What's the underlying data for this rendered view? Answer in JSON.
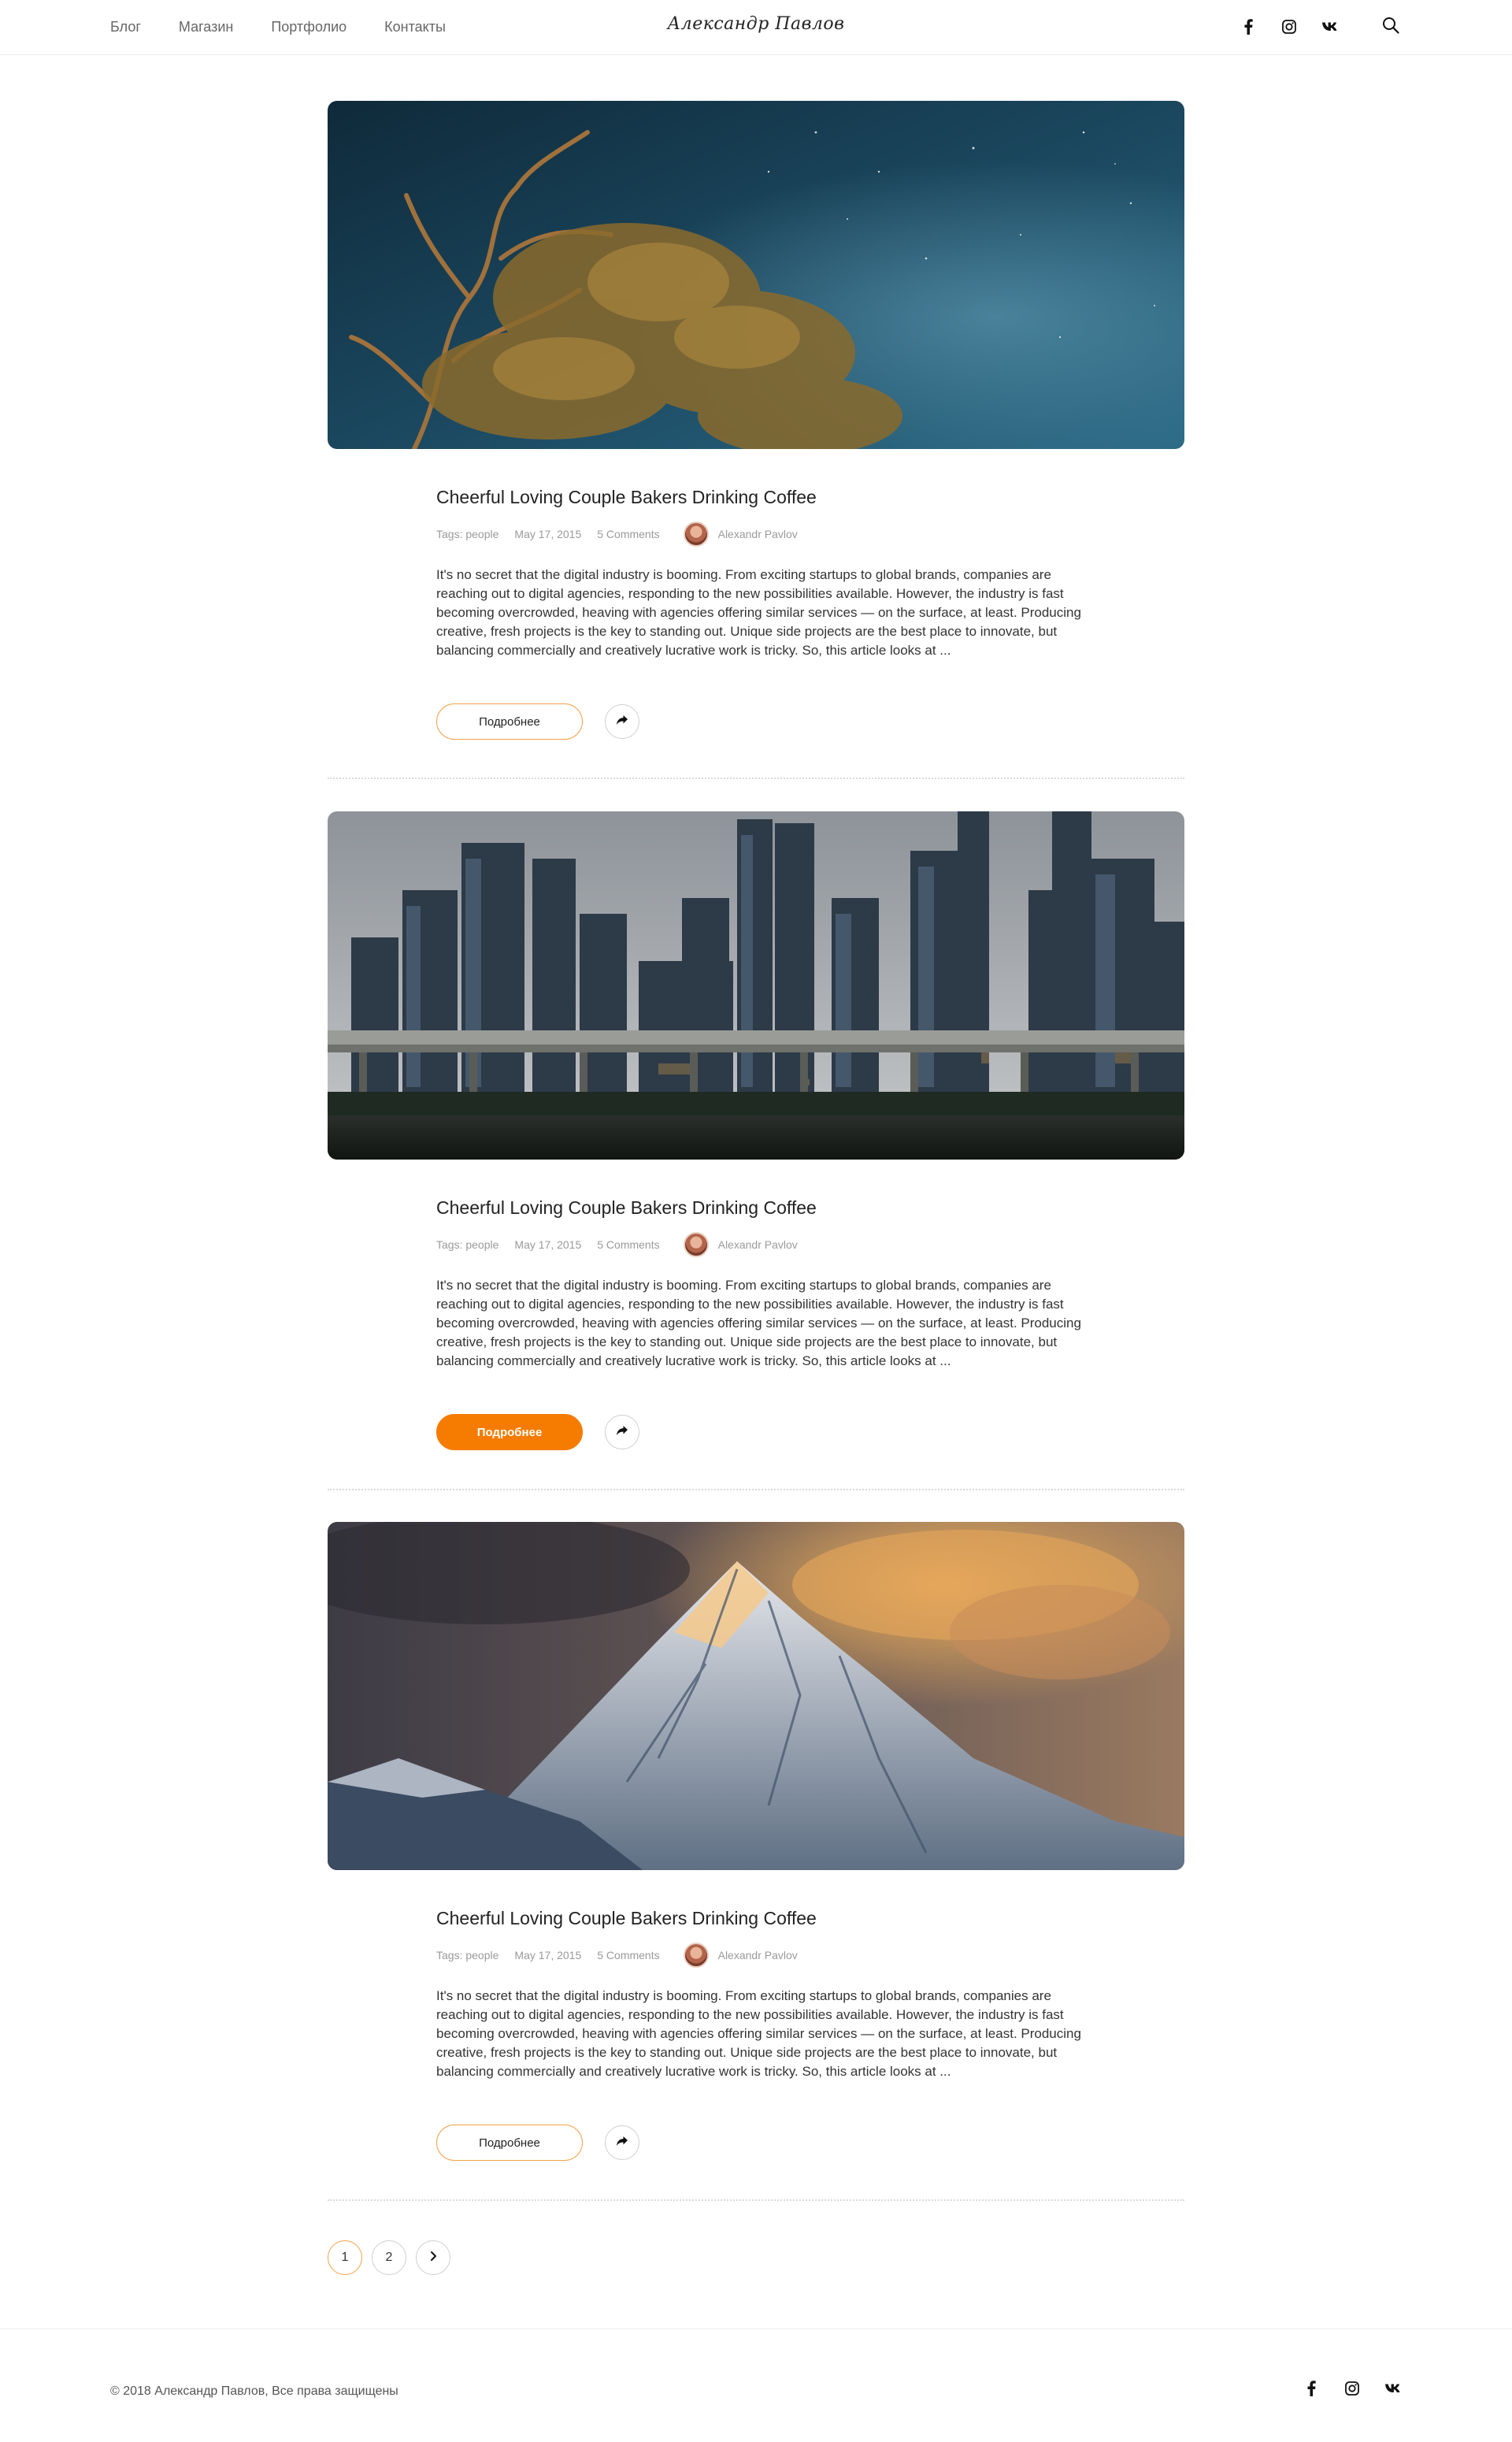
{
  "header": {
    "nav": [
      "Блог",
      "Магазин",
      "Портфолио",
      "Контакты"
    ],
    "logo": "Александр Павлов",
    "social_icons": [
      "facebook-icon",
      "instagram-icon",
      "vk-icon"
    ],
    "search_icon": "search-icon"
  },
  "posts": [
    {
      "image": "night-tree-photo",
      "title": "Cheerful Loving Couple Bakers Drinking Coffee",
      "tags": "Tags: people",
      "date": "May 17, 2015",
      "comments": "5 Comments",
      "author": "Alexandr Pavlov",
      "excerpt": "It's no secret that the digital industry is booming. From exciting startups to global brands, companies are reaching out to digital agencies, responding to the new possibilities available. However, the industry is fast becoming overcrowded, heaving with agencies offering similar services — on the surface, at least. Producing creative, fresh projects is the key to standing out. Unique side projects are the best place to innovate, but balancing commercially and creatively lucrative work is tricky. So, this article looks at ...",
      "button": "Подробнее",
      "button_active": false
    },
    {
      "image": "city-skyline-photo",
      "title": "Cheerful Loving Couple Bakers Drinking Coffee",
      "tags": "Tags: people",
      "date": "May 17, 2015",
      "comments": "5 Comments",
      "author": "Alexandr Pavlov",
      "excerpt": "It's no secret that the digital industry is booming. From exciting startups to global brands, companies are reaching out to digital agencies, responding to the new possibilities available. However, the industry is fast becoming overcrowded, heaving with agencies offering similar services — on the surface, at least. Producing creative, fresh projects is the key to standing out. Unique side projects are the best place to innovate, but balancing commercially and creatively lucrative work is tricky. So, this article looks at ...",
      "button": "Подробнее",
      "button_active": true
    },
    {
      "image": "mountain-peak-photo",
      "title": "Cheerful Loving Couple Bakers Drinking Coffee",
      "tags": "Tags: people",
      "date": "May 17, 2015",
      "comments": "5 Comments",
      "author": "Alexandr Pavlov",
      "excerpt": "It's no secret that the digital industry is booming. From exciting startups to global brands, companies are reaching out to digital agencies, responding to the new possibilities available. However, the industry is fast becoming overcrowded, heaving with agencies offering similar services — on the surface, at least. Producing creative, fresh projects is the key to standing out. Unique side projects are the best place to innovate, but balancing commercially and creatively lucrative work is tricky. So, this article looks at ...",
      "button": "Подробнее",
      "button_active": false
    }
  ],
  "pagination": {
    "pages": [
      "1",
      "2"
    ],
    "current": "1",
    "next_icon": "chevron-right-icon"
  },
  "footer": {
    "copyright": "© 2018 Александр Павлов, Все права защищены",
    "social_icons": [
      "facebook-icon",
      "instagram-icon",
      "vk-icon"
    ]
  },
  "colors": {
    "accent": "#f57c00",
    "accent_light": "#f5a14a",
    "text": "#222222",
    "muted": "#9a9a9a"
  }
}
